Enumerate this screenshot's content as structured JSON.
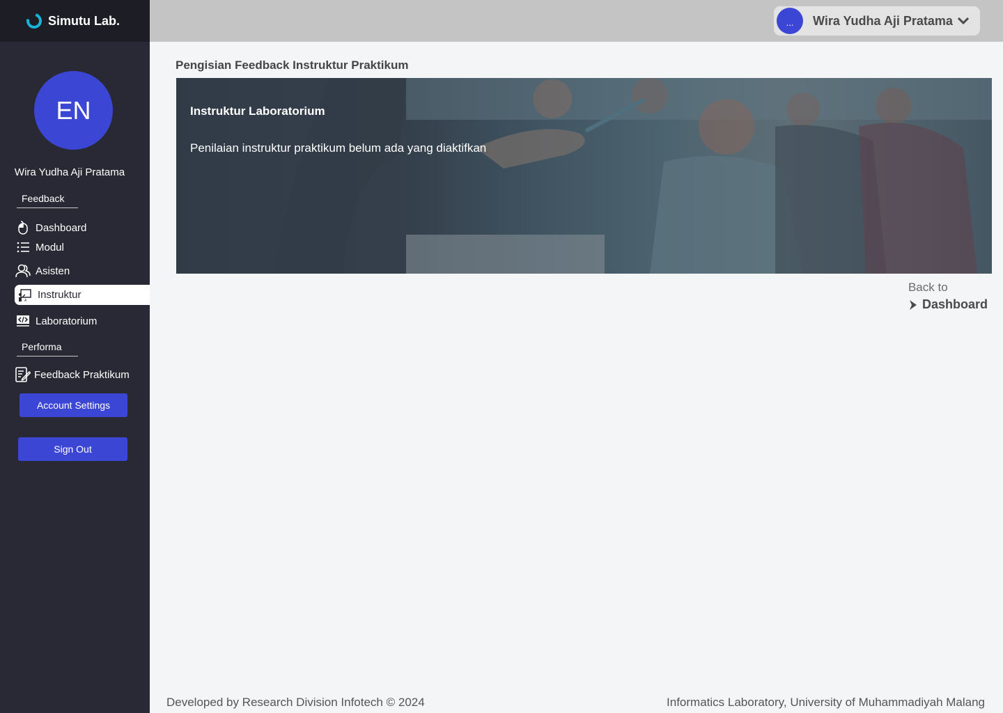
{
  "brand": {
    "name": "Simutu Lab."
  },
  "colors": {
    "sidebar": "#292935",
    "brand_bar": "#1d1d25",
    "accent": "#3c46d4",
    "brand_ring": "#16b6d6",
    "topbar": "#c4c4c4",
    "page_bg": "#f4f5f7"
  },
  "sidebar": {
    "avatar_initials": "EN",
    "user_name": "Wira Yudha Aji Pratama",
    "section_feedback": "Feedback",
    "section_performa": "Performa",
    "items": [
      {
        "label": "Dashboard",
        "icon": "mouse-pointer-icon"
      },
      {
        "label": "Modul",
        "icon": "list-icon"
      },
      {
        "label": "Asisten",
        "icon": "users-icon"
      },
      {
        "label": "Instruktur",
        "icon": "presentation-icon",
        "active": true
      },
      {
        "label": "Laboratorium",
        "icon": "code-window-icon"
      },
      {
        "label": "Feedback Praktikum",
        "icon": "edit-document-icon"
      }
    ],
    "account_settings": "Account Settings",
    "sign_out": "Sign Out"
  },
  "topbar": {
    "avatar_text": "...",
    "user_name": "Wira Yudha Aji Pratama",
    "caret_icon": "chevron-down-icon"
  },
  "main": {
    "page_title": "Pengisian Feedback Instruktur Praktikum",
    "banner_title": "Instruktur Laboratorium",
    "banner_text": "Penilaian instruktur praktikum belum ada yang diaktifkan",
    "back_label": "Back to",
    "back_link": "Dashboard"
  },
  "footer": {
    "left": "Developed by Research Division Infotech © 2024",
    "right": "Informatics Laboratory, University of Muhammadiyah Malang"
  }
}
